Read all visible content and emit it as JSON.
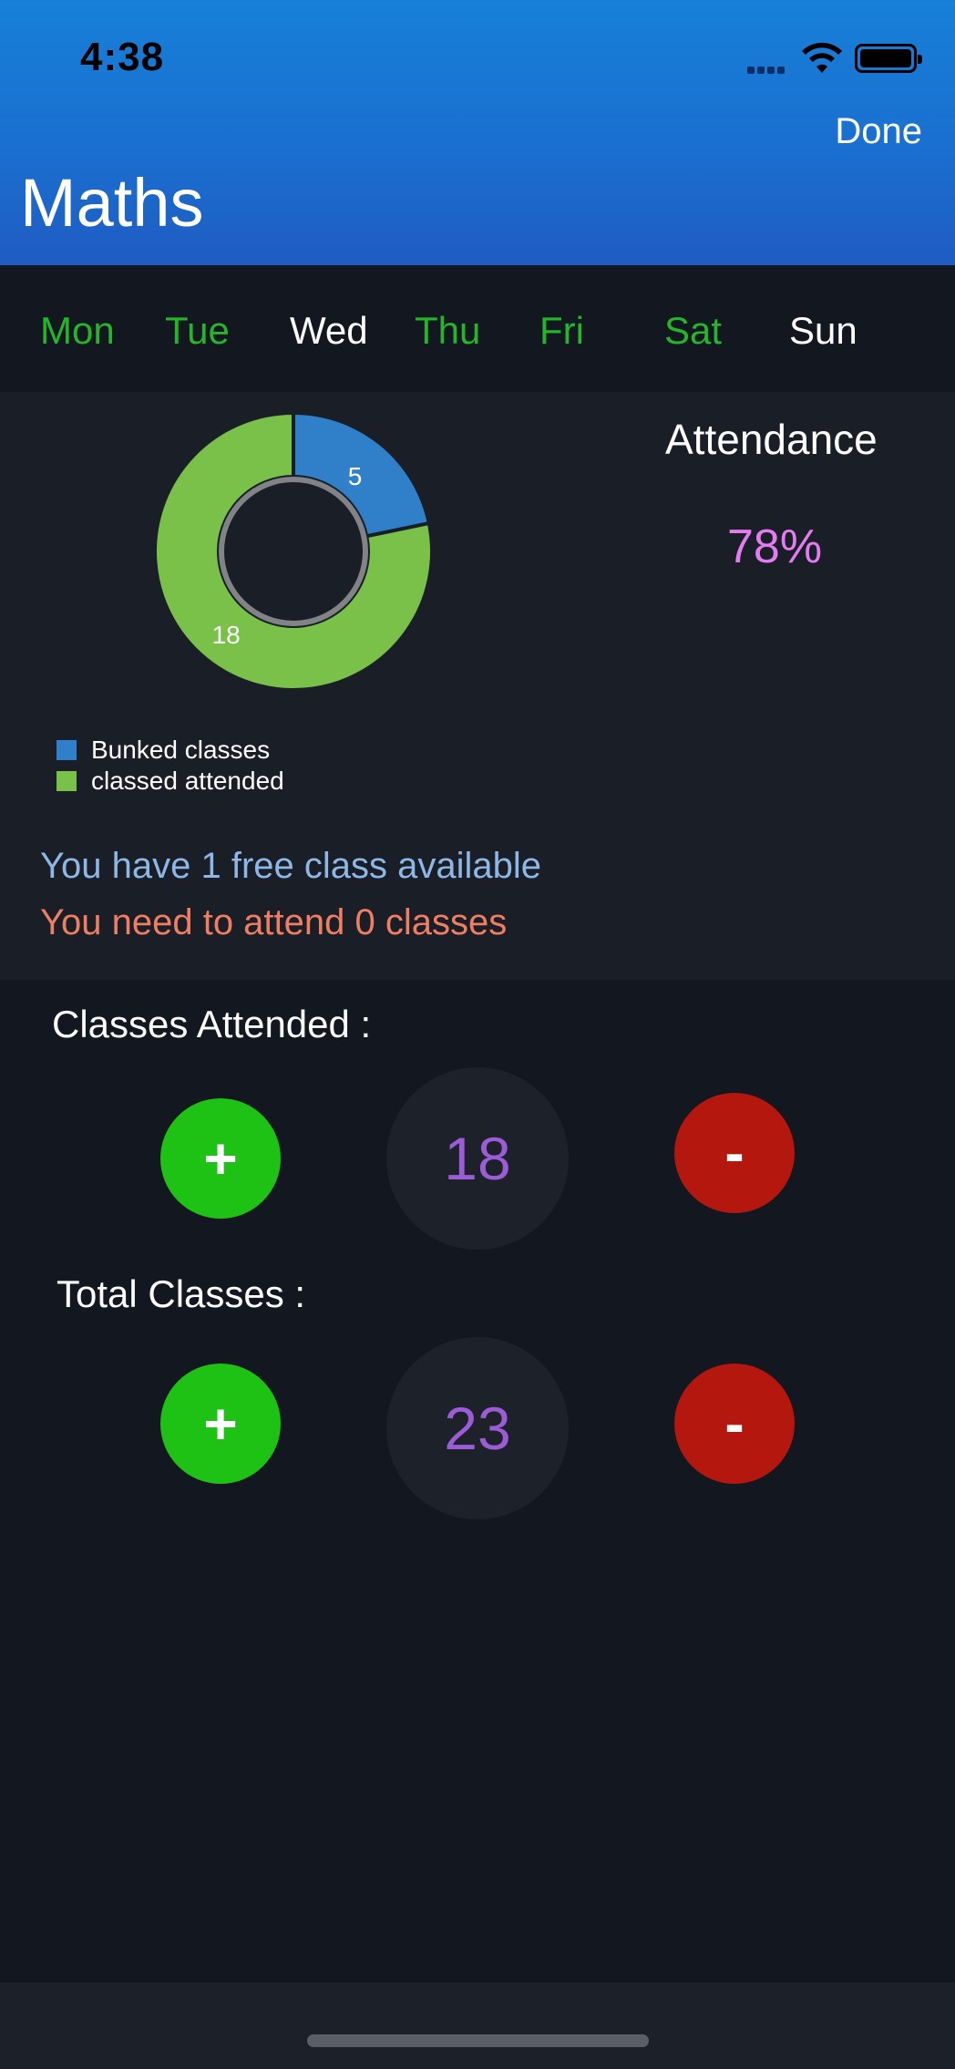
{
  "status_bar": {
    "time": "4:38"
  },
  "header": {
    "done_label": "Done",
    "title": "Maths"
  },
  "days": [
    {
      "label": "Mon",
      "color": "#24b52a"
    },
    {
      "label": "Tue",
      "color": "#24b52a"
    },
    {
      "label": "Wed",
      "color": "#ffffff"
    },
    {
      "label": "Thu",
      "color": "#24b52a"
    },
    {
      "label": "Fri",
      "color": "#24b52a"
    },
    {
      "label": "Sat",
      "color": "#24b52a"
    },
    {
      "label": "Sun",
      "color": "#ffffff"
    }
  ],
  "attendance": {
    "title": "Attendance",
    "percent": "78%"
  },
  "chart_data": {
    "type": "pie",
    "categories": [
      "Bunked classes",
      "classed attended"
    ],
    "values": [
      5,
      18
    ],
    "colors": [
      "#2f80c9",
      "#7ac14a"
    ],
    "data_labels": [
      "5",
      "18"
    ]
  },
  "messages": {
    "free": "You have 1 free class available",
    "need": "You need to attend 0 classes"
  },
  "attended": {
    "label": "Classes Attended :",
    "value": "18",
    "plus": "+",
    "minus": "-"
  },
  "total": {
    "label": "Total Classes :",
    "value": "23",
    "plus": "+",
    "minus": "-"
  },
  "colors": {
    "accent_green": "#1ec214",
    "accent_red": "#b3170d",
    "count_purple": "#9b5cd6",
    "header_blue": "#1a6fd0"
  }
}
